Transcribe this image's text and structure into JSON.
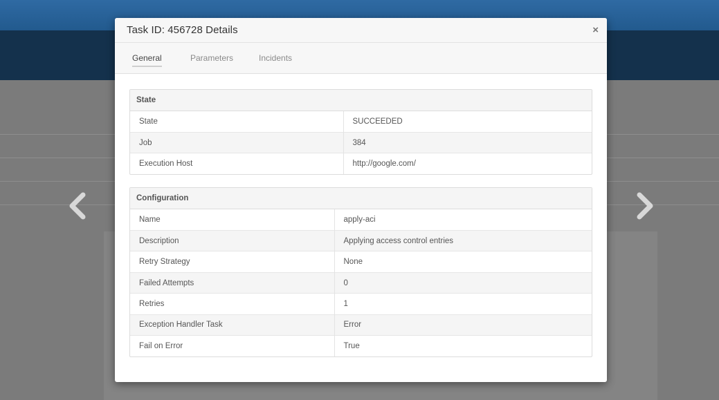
{
  "modal": {
    "title": "Task ID: 456728 Details",
    "close_glyph": "×",
    "tabs": [
      {
        "label": "General",
        "active": true
      },
      {
        "label": "Parameters",
        "active": false
      },
      {
        "label": "Incidents",
        "active": false
      }
    ]
  },
  "state_section": {
    "title": "State",
    "rows": [
      {
        "key": "State",
        "value": "SUCCEEDED"
      },
      {
        "key": "Job",
        "value": "384"
      },
      {
        "key": "Execution Host",
        "value": "http://google.com/"
      }
    ]
  },
  "config_section": {
    "title": "Configuration",
    "rows": [
      {
        "key": "Name",
        "value": "apply-aci"
      },
      {
        "key": "Description",
        "value": "Applying access control entries"
      },
      {
        "key": "Retry Strategy",
        "value": "None"
      },
      {
        "key": "Failed Attempts",
        "value": "0"
      },
      {
        "key": "Retries",
        "value": "1"
      },
      {
        "key": "Exception Handler Task",
        "value": "Error"
      },
      {
        "key": "Fail on Error",
        "value": "True"
      }
    ]
  },
  "icons": {
    "prev": "chevron-left-icon",
    "next": "chevron-right-icon",
    "close": "close-icon"
  },
  "colors": {
    "topbar": "#2a6399",
    "header": "#14314c",
    "overlay": "#7b7b7b",
    "modal_bg": "#ffffff"
  }
}
